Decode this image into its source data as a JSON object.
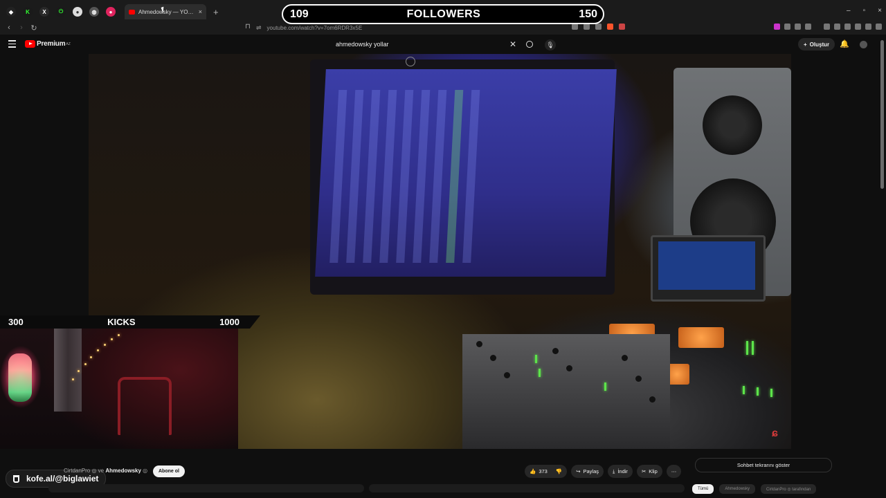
{
  "browser": {
    "tab_title": "Ahmedowsky — YOLLAR (Studio",
    "new_tab": "+",
    "close_tab": "×",
    "url": "youtube.com/watch?v=7om6RDR3x5E",
    "window_controls": [
      "–",
      "▫",
      "×"
    ]
  },
  "youtube": {
    "brand": "Premium",
    "brand_sup": "AZ",
    "search_query": "ahmedowsky yollar",
    "create_label": "Oluştur",
    "subscribe_label": "Abone ol",
    "channel_prefix": "CirtdanPro ◎ ve ",
    "channel_name": "Ahmedowsky",
    "verified": "◎",
    "actions": {
      "likes": "373",
      "share": "Paylaş",
      "download": "İndir",
      "clip": "Klip",
      "more": "⋯"
    },
    "chat_toggle": "Sohbet tekrarını göster",
    "bottom_pills": [
      "Tümü",
      "Ahmedowsky",
      "CirtdanPro ◎ tarafından"
    ]
  },
  "overlays": {
    "followers": {
      "current": "109",
      "label": "FOLLOWERS",
      "goal": "150"
    },
    "kicks": {
      "current": "300",
      "label": "KICKS",
      "goal": "1000"
    },
    "kofe": "kofe.al/@biglawiet"
  },
  "colors": {
    "youtube_red": "#ff0000",
    "background": "#0f0f0f",
    "overlay_bg": "#000000"
  },
  "icons": {
    "menu": "hamburger-icon",
    "search": "search-icon",
    "mic": "mic-icon",
    "bell": "bell-icon",
    "like": "thumbs-up-icon",
    "dislike": "thumbs-down-icon",
    "share": "share-icon",
    "download": "download-icon",
    "clip": "scissors-icon",
    "cup": "cup-icon"
  }
}
